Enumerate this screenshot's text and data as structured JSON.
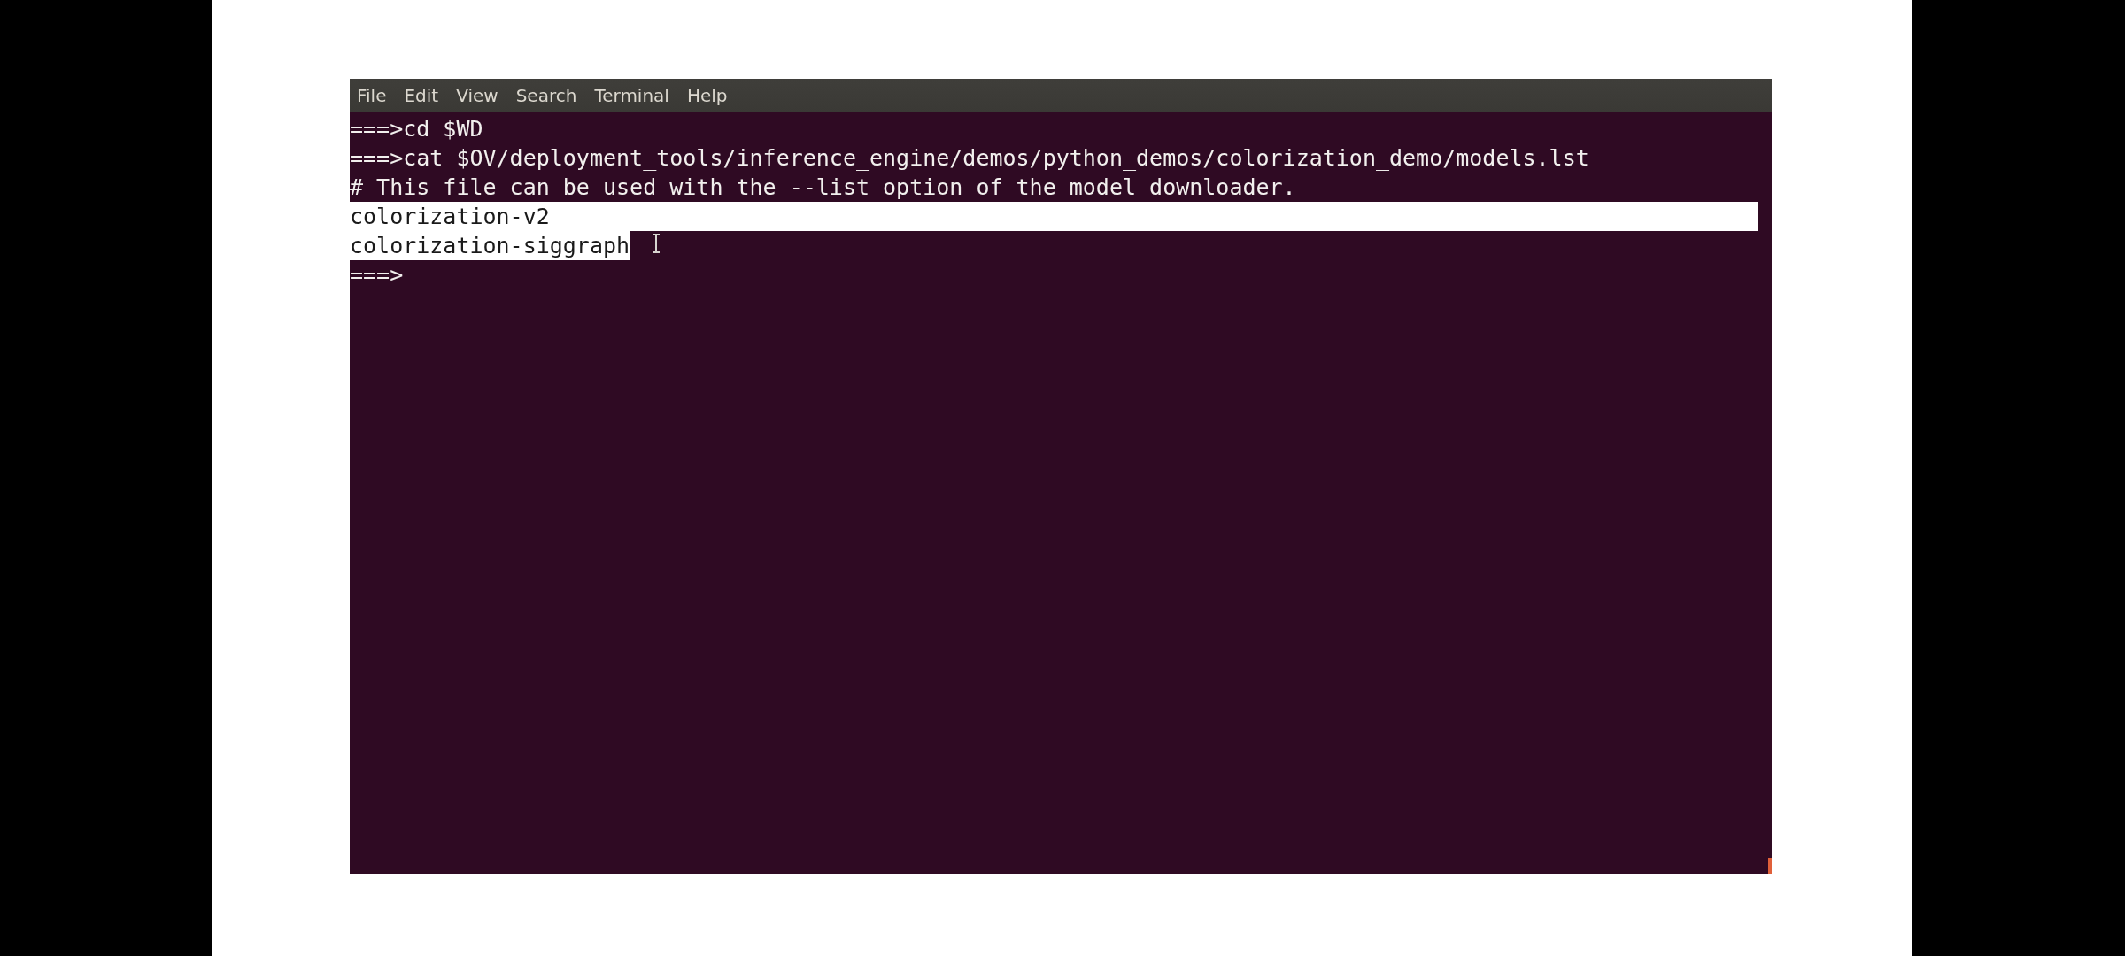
{
  "menu_bar": {
    "items": [
      "File",
      "Edit",
      "View",
      "Search",
      "Terminal",
      "Help"
    ]
  },
  "terminal": {
    "lines": [
      {
        "text": "===>cd $WD",
        "selected": false
      },
      {
        "text": "===>cat $OV/deployment_tools/inference_engine/demos/python_demos/colorization_demo/models.lst",
        "selected": false
      },
      {
        "text": "# This file can be used with the --list option of the model downloader.",
        "selected": false
      },
      {
        "text": "colorization-v2",
        "selected": true
      },
      {
        "text": "colorization-siggraph",
        "selected": true
      },
      {
        "text": "===>",
        "selected": false
      }
    ]
  }
}
